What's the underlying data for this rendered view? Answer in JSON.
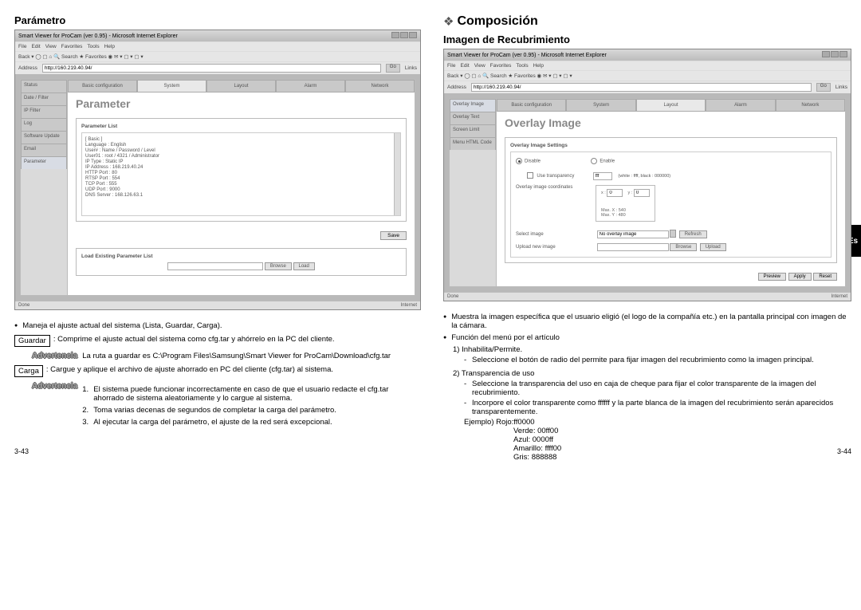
{
  "lang_tab": "Es",
  "left": {
    "section_title": "Parámetro",
    "shot": {
      "window_title": "Smart Viewer for ProCam (ver 0.95) - Microsoft Internet Explorer",
      "menu": [
        "File",
        "Edit",
        "View",
        "Favorites",
        "Tools",
        "Help"
      ],
      "toolbar": "Back  ▾  ◯  ▢  ⌂  🔍 Search  ★ Favorites  ◉  ✉ ▾  ▢ ▾  ▢ ▾",
      "address_label": "Address",
      "address_url": "http://160.219.40.94/",
      "go": "Go",
      "top_tabs": [
        "Basic configuration",
        "System",
        "Layout",
        "Alarm",
        "Network"
      ],
      "top_tab_selected": 1,
      "sidebar": [
        "Status",
        "Date / Filter",
        "IP Filter",
        "Log",
        "Software Update",
        "Email",
        "Parameter"
      ],
      "sidebar_selected": 6,
      "panel_title": "Parameter",
      "box1_header": "Parameter List",
      "box1_lines": [
        "[ Basic ]",
        "Language : English",
        "User# : Name / Password / Level",
        "User01 : root / 4321 / Administrator",
        "",
        "IP Type : Static IP",
        "IP Address : 168.219.40.24",
        "HTTP Port : 80",
        "RTSP Port : 554",
        "TCP Port : 555",
        "UDP Port : 9000",
        "DNS Server : 168.126.63.1"
      ],
      "save_btn": "Save",
      "box2_header": "Load Existing Parameter List",
      "browse_btn": "Browse",
      "load_btn": "Load",
      "status_left": "Done",
      "status_right": "Internet"
    },
    "txt": {
      "bullet1": "Maneja el ajuste actual del sistema (Lista, Guardar, Carga).",
      "guardar_lbl": "Guardar",
      "guardar_txt": ": Comprime el ajuste actual del sistema como cfg.tar y ahórrelo en la PC del cliente.",
      "adv1_lbl": "Advertencia",
      "adv1_txt": "La ruta a guardar es C:\\Program Files\\Samsung\\Smart Viewer for ProCam\\Download\\cfg.tar",
      "carga_lbl": "Carga",
      "carga_txt": ": Cargue y aplique el archivo de ajuste ahorrado en PC del cliente (cfg.tar) al sistema.",
      "adv2_lbl": "Advertencia",
      "adv2_items": [
        "El sistema puede funcionar incorrectamente en caso de que el usuario redacte el cfg.tar ahorrado de sistema aleatoriamente y lo cargue al sistema.",
        "Toma varias decenas de segundos de completar la carga del parámetro.",
        "Al ejecutar la carga del parámetro, el ajuste de la red será excepcional."
      ]
    },
    "pagenum": "3-43"
  },
  "right": {
    "big_title": "Composición",
    "section_title": "Imagen de Recubrimiento",
    "shot": {
      "window_title": "Smart Viewer for ProCam (ver 0.95) - Microsoft Internet Explorer",
      "menu": [
        "File",
        "Edit",
        "View",
        "Favorites",
        "Tools",
        "Help"
      ],
      "toolbar": "Back  ▾  ◯  ▢  ⌂  🔍 Search  ★ Favorites  ◉  ✉ ▾  ▢ ▾  ▢ ▾",
      "address_label": "Address",
      "address_url": "http://160.219.40.94/",
      "go": "Go",
      "top_tabs": [
        "Basic configuration",
        "System",
        "Layout",
        "Alarm",
        "Network"
      ],
      "top_tab_selected": 2,
      "sidebar": [
        "Overlay Image",
        "Overlay Text",
        "Screen Limit",
        "Menu HTML Code"
      ],
      "sidebar_selected": 0,
      "panel_title": "Overlay Image",
      "box_header": "Overlay Image Settings",
      "disable": "Disable",
      "enable": "Enable",
      "use_transparency": "Use transparency",
      "color_sample": "fff",
      "color_hint": "(white : ffff, black : 000000)",
      "coords_label": "Overlay image coordinates",
      "coord_x": "x :",
      "coord_xv": "0",
      "coord_y": "y :",
      "coord_yv": "0",
      "max_x": "Max. X : 540",
      "max_y": "Max. Y : 480",
      "select_image": "Select image",
      "select_val": "No overlay image",
      "refresh": "Refresh",
      "upload_new": "Upload new image",
      "browse": "Browse",
      "upload": "Upload",
      "btns": [
        "Preview",
        "Apply",
        "Reset"
      ],
      "status_left": "Done",
      "status_right": "Internet"
    },
    "txt": {
      "bullet1": "Muestra la imagen específica que el usuario eligió (el logo de la compañía etc.) en la pantalla principal con imagen de la cámara.",
      "bullet2": "Función del menú por el artículo",
      "item1": "1) Inhabilita/Permite.",
      "item1_dash": "Seleccione el botón de radio del permite para fijar imagen del recubrimiento como la imagen principal.",
      "item2": "2) Transparencia de uso",
      "item2_dash1": "Seleccione la transparencia del uso en caja de cheque para fijar el color transparente de la imagen del recubrimiento.",
      "item2_dash2": "Incorpore el color transparente como ffffff y la parte blanca de la imagen del recubrimiento serán aparecidos transparentemente.",
      "example": "Ejemplo) Rojo:ff0000",
      "colors": [
        "Verde: 00ff00",
        "Azul: 0000ff",
        "Amarillo: ffff00",
        "Gris: 888888"
      ]
    },
    "pagenum": "3-44"
  }
}
